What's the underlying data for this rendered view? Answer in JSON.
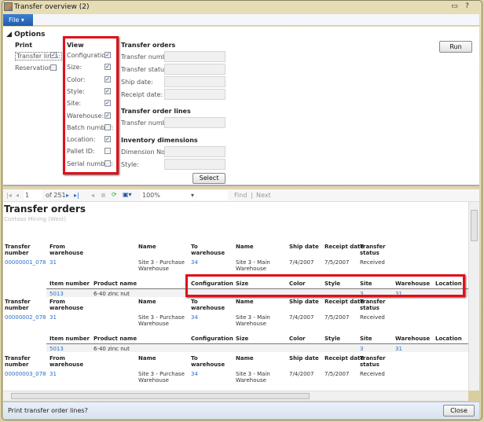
{
  "window": {
    "title": "Transfer overview (2)",
    "file_menu": "File"
  },
  "options": {
    "heading": "Options",
    "print": {
      "heading": "Print",
      "items": [
        {
          "label": "Transfer lines:",
          "checked": true
        },
        {
          "label": "Reservations:",
          "checked": false
        }
      ]
    },
    "view": {
      "heading": "View",
      "items": [
        {
          "label": "Configuration:",
          "checked": true
        },
        {
          "label": "Size:",
          "checked": true
        },
        {
          "label": "Color:",
          "checked": true
        },
        {
          "label": "Style:",
          "checked": true
        },
        {
          "label": "Site:",
          "checked": true
        },
        {
          "label": "Warehouse:",
          "checked": true
        },
        {
          "label": "Batch number:",
          "checked": false
        },
        {
          "label": "Location:",
          "checked": true
        },
        {
          "label": "Pallet ID:",
          "checked": false
        },
        {
          "label": "Serial number:",
          "checked": false
        }
      ]
    },
    "transfer_orders": {
      "heading": "Transfer orders",
      "fields": [
        "Transfer number:",
        "Transfer status:",
        "Ship date:",
        "Receipt date:"
      ]
    },
    "transfer_order_lines": {
      "heading": "Transfer order lines",
      "fields": [
        "Transfer number:"
      ]
    },
    "inventory_dimensions": {
      "heading": "Inventory dimensions",
      "fields": [
        "Dimension No.",
        "Style:"
      ]
    },
    "select_label": "Select",
    "run_label": "Run"
  },
  "toolbar": {
    "page": "1",
    "of": "of",
    "total": "251",
    "zoom": "100%",
    "find": "Find",
    "sep": "|",
    "next": "Next"
  },
  "report": {
    "title": "Transfer orders",
    "company": "Contoso Mining (West)",
    "order_headers": [
      "Transfer number",
      "From warehouse",
      "Name",
      "To warehouse",
      "Name",
      "Ship date",
      "Receipt date",
      "Transfer status"
    ],
    "line_headers": [
      "Item number",
      "Product name",
      "Configuration",
      "Size",
      "Color",
      "Style",
      "Site",
      "Warehouse",
      "Location"
    ],
    "orders": [
      {
        "cells": [
          "00000001_078",
          "31",
          "Site 3 - Purchase Warehouse",
          "34",
          "Site 3 - Main Warehouse",
          "7/4/2007",
          "7/5/2007",
          "Received"
        ],
        "line": [
          "5013",
          "6-40 zinc nut",
          "",
          "",
          "",
          "",
          "3",
          "31",
          ""
        ]
      },
      {
        "cells": [
          "00000002_078",
          "31",
          "Site 3 - Purchase Warehouse",
          "34",
          "Site 3 - Main Warehouse",
          "7/4/2007",
          "7/5/2007",
          "Received"
        ],
        "line": [
          "5013",
          "6-40 zinc nut",
          "",
          "",
          "",
          "",
          "3",
          "31",
          ""
        ]
      },
      {
        "cells": [
          "00000003_078",
          "31",
          "Site 3 - Purchase Warehouse",
          "34",
          "Site 3 - Main Warehouse",
          "7/4/2007",
          "7/5/2007",
          "Received"
        ]
      }
    ]
  },
  "status": {
    "text": "Print transfer order lines?",
    "close_label": "Close"
  }
}
